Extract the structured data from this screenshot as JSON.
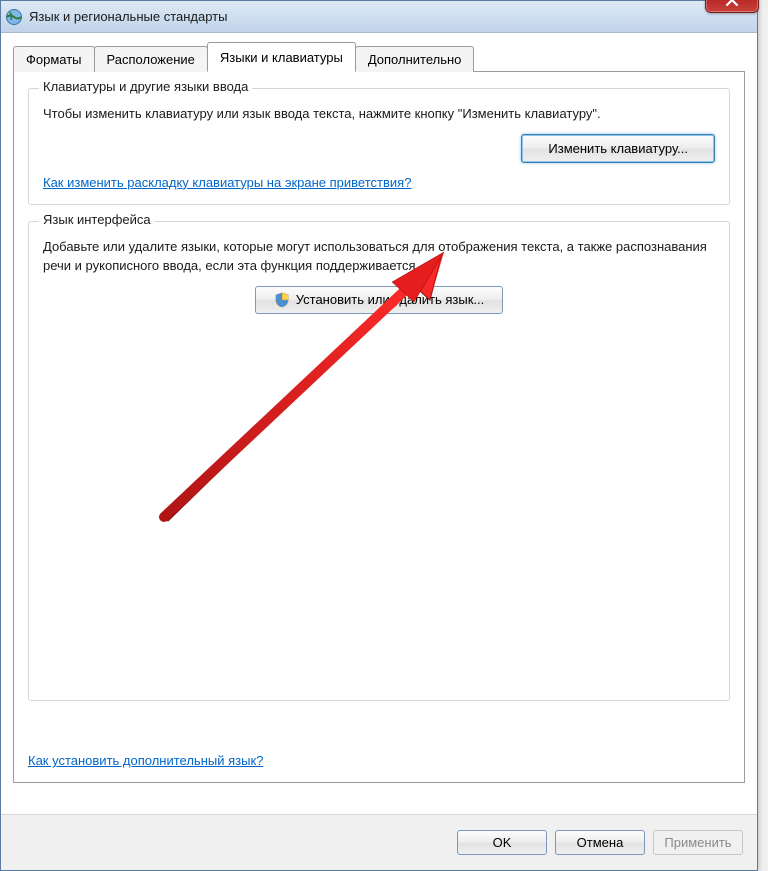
{
  "window": {
    "title": "Язык и региональные стандарты",
    "close_label": "X"
  },
  "tabs": {
    "items": [
      {
        "label": "Форматы"
      },
      {
        "label": "Расположение"
      },
      {
        "label": "Языки и клавиатуры"
      },
      {
        "label": "Дополнительно"
      }
    ],
    "active_index": 2
  },
  "group_keyboards": {
    "legend": "Клавиатуры и другие языки ввода",
    "text": "Чтобы изменить клавиатуру или язык ввода текста, нажмите кнопку \"Изменить клавиатуру\".",
    "button": "Изменить клавиатуру...",
    "link": "Как изменить раскладку клавиатуры на экране приветствия?"
  },
  "group_display_lang": {
    "legend": "Язык интерфейса",
    "text": "Добавьте или удалите языки, которые могут использоваться для отображения текста, а также распознавания речи и рукописного ввода, если эта функция поддерживается.",
    "button": "Установить или удалить язык..."
  },
  "bottom_link": "Как установить дополнительный язык?",
  "dialog_buttons": {
    "ok": "OK",
    "cancel": "Отмена",
    "apply": "Применить"
  }
}
